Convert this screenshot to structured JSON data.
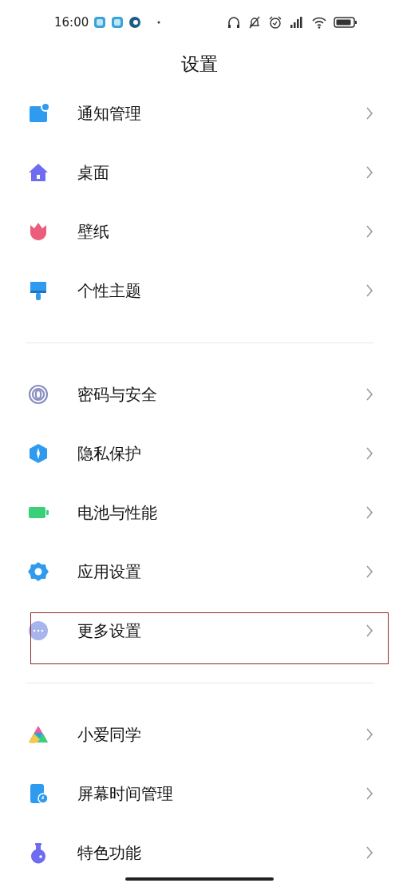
{
  "status_bar": {
    "time": "16:00"
  },
  "title": "设置",
  "groups": [
    {
      "items": [
        {
          "label": "通知管理",
          "highlighted": false
        },
        {
          "label": "桌面",
          "highlighted": false
        },
        {
          "label": "壁纸",
          "highlighted": false
        },
        {
          "label": "个性主题",
          "highlighted": false
        }
      ]
    },
    {
      "items": [
        {
          "label": "密码与安全",
          "highlighted": false
        },
        {
          "label": "隐私保护",
          "highlighted": false
        },
        {
          "label": "电池与性能",
          "highlighted": false
        },
        {
          "label": "应用设置",
          "highlighted": false
        },
        {
          "label": "更多设置",
          "highlighted": true
        }
      ]
    },
    {
      "items": [
        {
          "label": "小爱同学",
          "highlighted": false
        },
        {
          "label": "屏幕时间管理",
          "highlighted": false
        },
        {
          "label": "特色功能",
          "highlighted": false
        }
      ]
    }
  ]
}
